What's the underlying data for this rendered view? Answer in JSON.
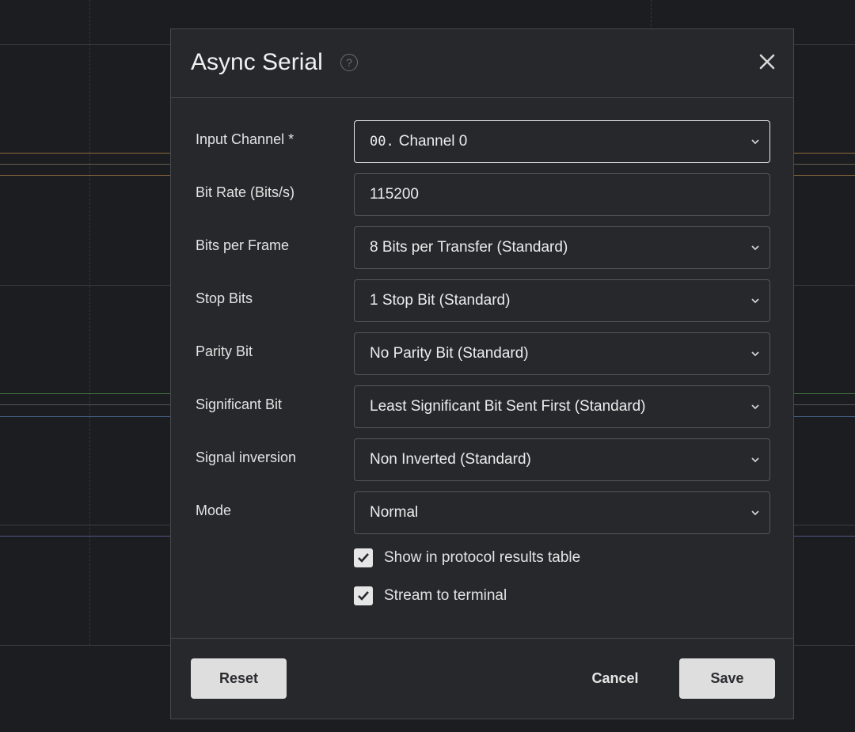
{
  "dialog": {
    "title": "Async Serial",
    "help_icon": "question-circle-icon",
    "close_icon": "close-icon"
  },
  "fields": [
    {
      "label": "Input Channel *",
      "value": "Channel 0",
      "prefix": "00.",
      "type": "select",
      "focused": true
    },
    {
      "label": "Bit Rate (Bits/s)",
      "value": "115200",
      "type": "text"
    },
    {
      "label": "Bits per Frame",
      "value": "8 Bits per Transfer (Standard)",
      "type": "select"
    },
    {
      "label": "Stop Bits",
      "value": "1 Stop Bit (Standard)",
      "type": "select"
    },
    {
      "label": "Parity Bit",
      "value": "No Parity Bit (Standard)",
      "type": "select"
    },
    {
      "label": "Significant Bit",
      "value": "Least Significant Bit Sent First (Standard)",
      "type": "select"
    },
    {
      "label": "Signal inversion",
      "value": "Non Inverted (Standard)",
      "type": "select"
    },
    {
      "label": "Mode",
      "value": "Normal",
      "type": "select"
    }
  ],
  "checkboxes": [
    {
      "label": "Show in protocol results table",
      "checked": true
    },
    {
      "label": "Stream to terminal",
      "checked": true
    }
  ],
  "footer": {
    "reset_label": "Reset",
    "cancel_label": "Cancel",
    "save_label": "Save"
  },
  "colors": {
    "background": "#1c1d20",
    "dialog": "#27282c",
    "border": "#46484d",
    "button": "#dedede",
    "trace_orange": "#b5874a",
    "trace_green": "#4f8a4a",
    "trace_blue": "#4f79a8"
  }
}
